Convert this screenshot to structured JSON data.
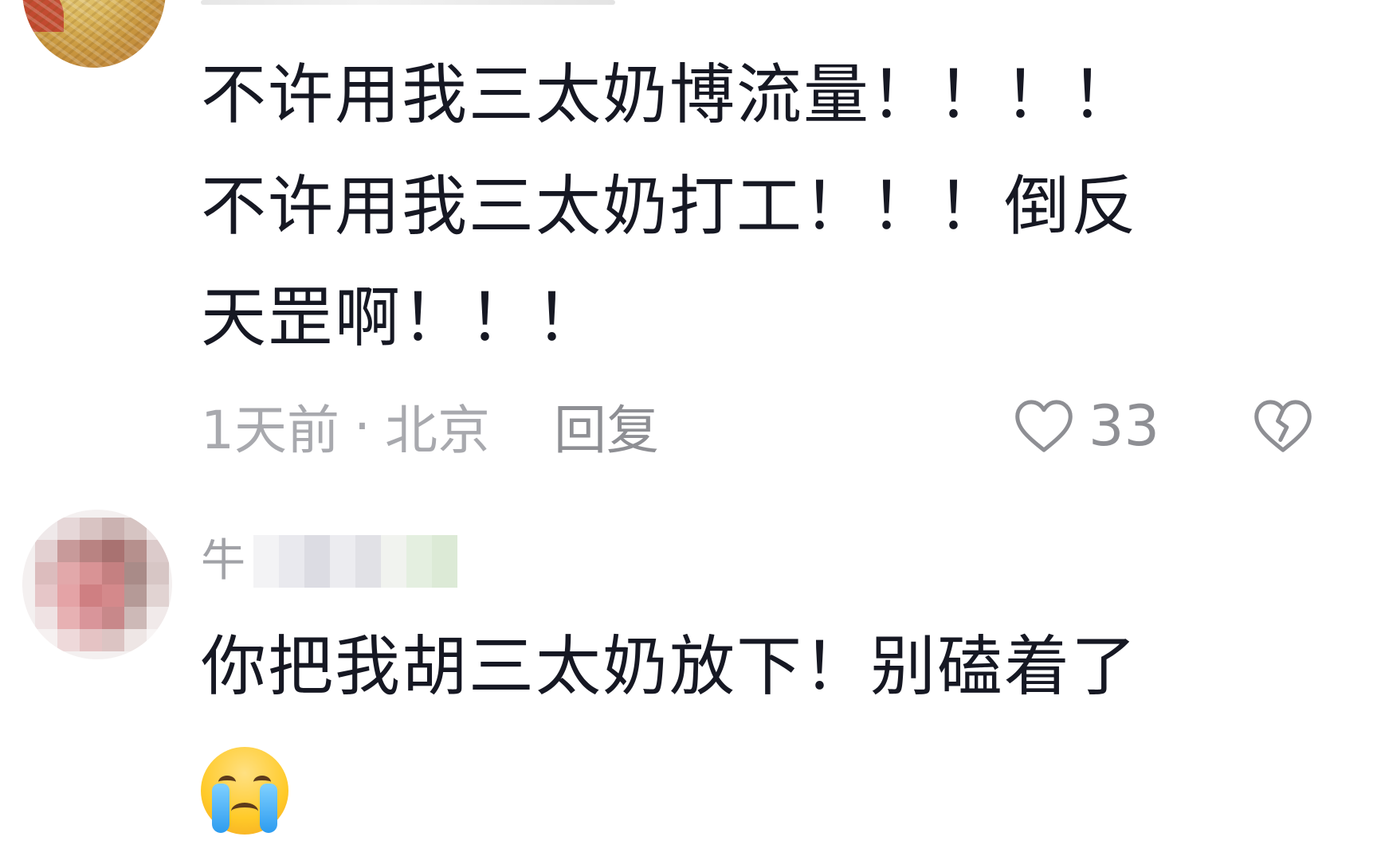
{
  "comments": [
    {
      "text_lines": [
        "不许用我三太奶博流量！！！！",
        "不许用我三太奶打工！！！倒反",
        "天罡啊！！！"
      ],
      "time": "1天前",
      "separator": "·",
      "location": "北京",
      "reply_label": "回复",
      "like_count": "33",
      "icons": {
        "like": "heart-outline-icon",
        "dislike": "broken-heart-icon"
      }
    },
    {
      "username_visible": "牛",
      "text": "你把我胡三太奶放下！别磕着了",
      "emoji": "loudly-crying-face-emoji"
    }
  ],
  "colors": {
    "text_primary": "#161823",
    "text_secondary": "#a1a2a7",
    "background": "#ffffff"
  }
}
